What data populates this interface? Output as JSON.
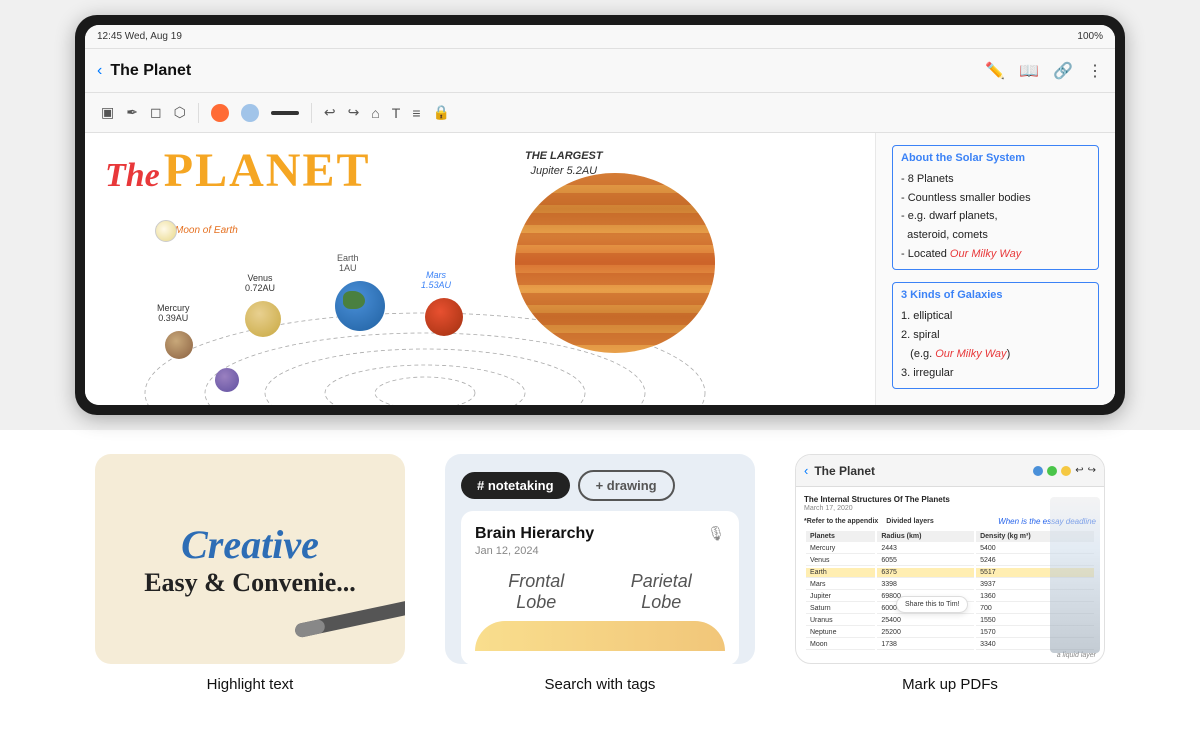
{
  "tablet": {
    "status_bar": {
      "time": "12:45 Wed, Aug 19",
      "battery": "100%",
      "signal": "●●●"
    },
    "app_bar": {
      "title": "The Planet",
      "back_label": "‹"
    },
    "toolbar": {
      "colors": [
        "#FF6B35",
        "#4A90D9",
        "#cccccc"
      ],
      "tools": [
        "⬜",
        "✏️",
        "◯",
        "⬡",
        "↩",
        "↪",
        "🏠",
        "T",
        "A",
        "⊞",
        "◇",
        "🔒"
      ]
    },
    "canvas": {
      "title_the": "The",
      "title_planet": "PLANET",
      "largest_label": "THE LARGEST",
      "largest_value": "Jupiter 5.2AU",
      "moon_label": "The Moon of Earth",
      "planets": [
        {
          "name": "Mercury",
          "distance": "0.39AU"
        },
        {
          "name": "Venus",
          "distance": "0.72AU"
        },
        {
          "name": "Earth",
          "distance": "1AU"
        },
        {
          "name": "Mars",
          "distance": "1.53AU"
        },
        {
          "name": "Jupiter",
          "distance": "5.2AU"
        }
      ]
    },
    "notes": {
      "box1_title": "About the Solar System",
      "box1_items": [
        "8 Planets",
        "Countless smaller bodies",
        "e.g. dwarf planets, asteroid, comets",
        "Located Our Milky Way"
      ],
      "box2_title": "3 Kinds of Galaxies",
      "box2_items": [
        "elliptical",
        "spiral (e.g. Our Milky Way)",
        "irregular"
      ]
    }
  },
  "features": [
    {
      "id": "highlight-text",
      "label": "Highlight text",
      "thumb_text1": "Creative",
      "thumb_text2": "Easy & Convenie..."
    },
    {
      "id": "search-tags",
      "label": "Search with tags",
      "tag1": "# notetaking",
      "tag2": "+ drawing",
      "note_title": "Brain Hierarchy",
      "note_date": "Jan 12, 2024",
      "lobe1": "Frontal\nLobe",
      "lobe2": "Parietal\nLobe"
    },
    {
      "id": "markup-pdfs",
      "label": "Mark up PDFs",
      "app_title": "The Planet",
      "pdf_title": "The Internal Structures Of The Planets",
      "pdf_date": "March 17, 2020",
      "annotation": "When is the essay deadline",
      "share_text": "Share this\nto Tim!",
      "liquid_text": "a liquid layer",
      "refer_text": "*Refer to the appendix",
      "divided_text": "Divided layers"
    }
  ]
}
